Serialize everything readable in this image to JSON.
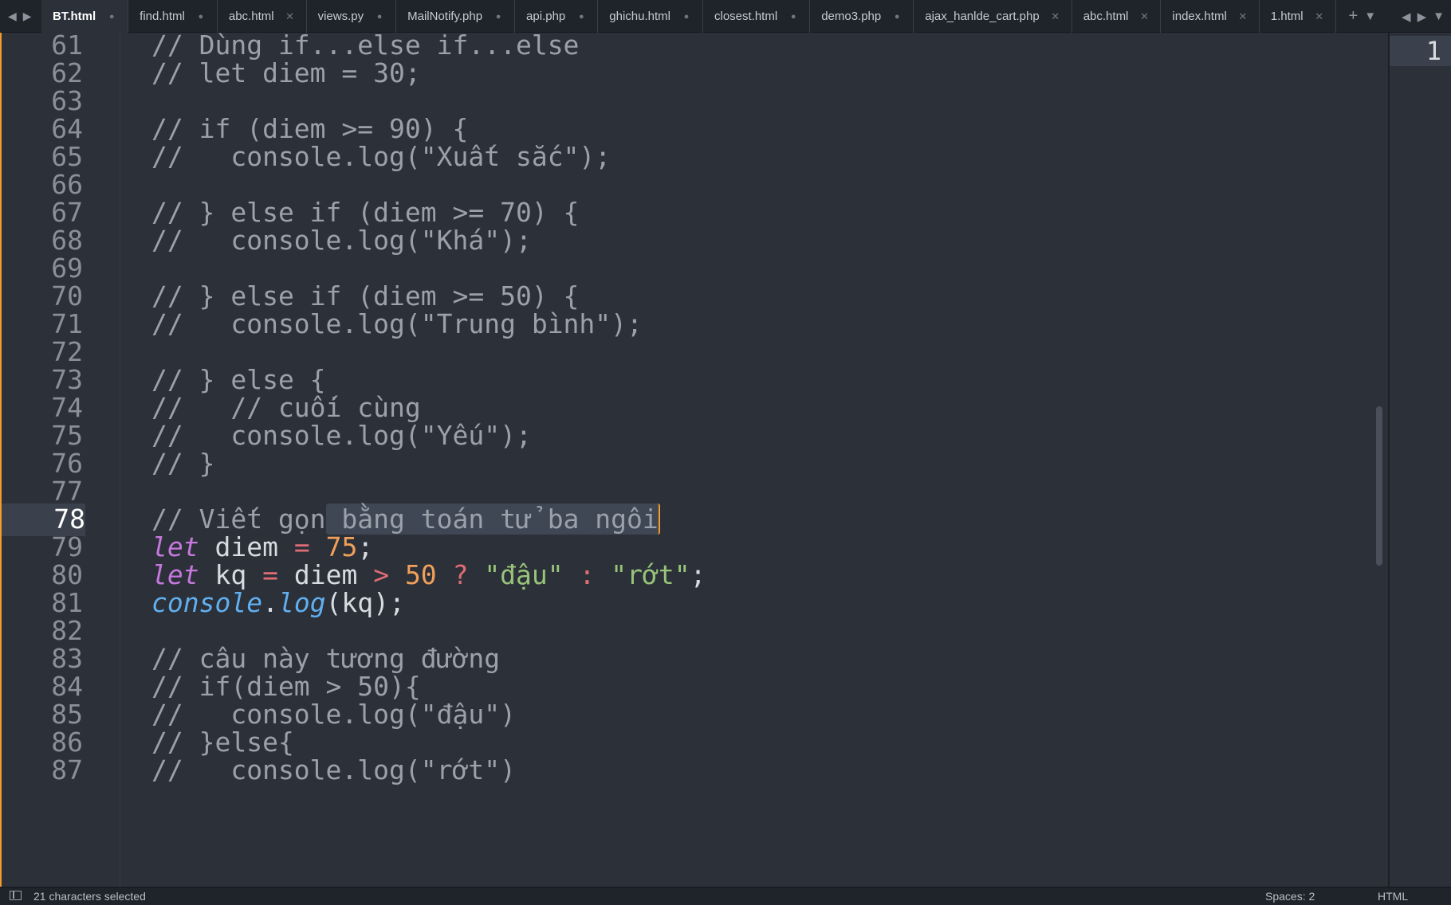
{
  "tabs": [
    {
      "label": "BT.html",
      "control": "●",
      "active": true
    },
    {
      "label": "find.html",
      "control": "●"
    },
    {
      "label": "abc.html",
      "control": "✕"
    },
    {
      "label": "views.py",
      "control": "●"
    },
    {
      "label": "MailNotify.php",
      "control": "●"
    },
    {
      "label": "api.php",
      "control": "●"
    },
    {
      "label": "ghichu.html",
      "control": "●"
    },
    {
      "label": "closest.html",
      "control": "●"
    },
    {
      "label": "demo3.php",
      "control": "●"
    },
    {
      "label": "ajax_hanlde_cart.php",
      "control": "✕"
    },
    {
      "label": "abc.html",
      "control": "✕"
    },
    {
      "label": "index.html",
      "control": "✕"
    },
    {
      "label": "1.html",
      "control": "✕"
    }
  ],
  "lines": [
    {
      "n": "61",
      "tokens": [
        [
          "cm",
          "// Dùng if...else if...else"
        ]
      ]
    },
    {
      "n": "62",
      "tokens": [
        [
          "cm",
          "// let diem = 30;"
        ]
      ]
    },
    {
      "n": "63",
      "tokens": []
    },
    {
      "n": "64",
      "tokens": [
        [
          "cm",
          "// if (diem >= 90) {"
        ]
      ]
    },
    {
      "n": "65",
      "tokens": [
        [
          "cm",
          "//   console.log(\"Xuất sắc\");"
        ]
      ]
    },
    {
      "n": "66",
      "tokens": []
    },
    {
      "n": "67",
      "tokens": [
        [
          "cm",
          "// } else if (diem >= 70) {"
        ]
      ]
    },
    {
      "n": "68",
      "tokens": [
        [
          "cm",
          "//   console.log(\"Khá\");"
        ]
      ]
    },
    {
      "n": "69",
      "tokens": []
    },
    {
      "n": "70",
      "tokens": [
        [
          "cm",
          "// } else if (diem >= 50) {"
        ]
      ]
    },
    {
      "n": "71",
      "tokens": [
        [
          "cm",
          "//   console.log(\"Trung bình\");"
        ]
      ]
    },
    {
      "n": "72",
      "tokens": []
    },
    {
      "n": "73",
      "tokens": [
        [
          "cm",
          "// } else {"
        ]
      ]
    },
    {
      "n": "74",
      "tokens": [
        [
          "cm",
          "//   // cuối cùng"
        ]
      ]
    },
    {
      "n": "75",
      "tokens": [
        [
          "cm",
          "//   console.log(\"Yếu\");"
        ]
      ]
    },
    {
      "n": "76",
      "tokens": [
        [
          "cm",
          "// }"
        ]
      ]
    },
    {
      "n": "77",
      "tokens": []
    },
    {
      "n": "78",
      "current": true,
      "tokens": [
        [
          "cm",
          "// Viết gọn"
        ],
        [
          "cm sel caret",
          " bằng toán tử ba ngôi"
        ]
      ]
    },
    {
      "n": "79",
      "tokens": [
        [
          "kw",
          "let"
        ],
        [
          "",
          " diem "
        ],
        [
          "op",
          "="
        ],
        [
          "",
          " "
        ],
        [
          "num",
          "75"
        ],
        [
          "",
          ";"
        ]
      ]
    },
    {
      "n": "80",
      "tokens": [
        [
          "kw",
          "let"
        ],
        [
          "",
          " kq "
        ],
        [
          "op",
          "="
        ],
        [
          "",
          " diem "
        ],
        [
          "op",
          ">"
        ],
        [
          "",
          " "
        ],
        [
          "num",
          "50"
        ],
        [
          "",
          " "
        ],
        [
          "op",
          "?"
        ],
        [
          "",
          " "
        ],
        [
          "str",
          "\"đậu\""
        ],
        [
          "",
          " "
        ],
        [
          "op",
          ":"
        ],
        [
          "",
          " "
        ],
        [
          "str",
          "\"rớt\""
        ],
        [
          "",
          ";"
        ]
      ]
    },
    {
      "n": "81",
      "tokens": [
        [
          "fn",
          "console"
        ],
        [
          "",
          "."
        ],
        [
          "fn",
          "log"
        ],
        [
          "",
          "(kq);"
        ]
      ]
    },
    {
      "n": "82",
      "tokens": []
    },
    {
      "n": "83",
      "tokens": [
        [
          "cm",
          "// câu này tương đường"
        ]
      ]
    },
    {
      "n": "84",
      "tokens": [
        [
          "cm",
          "// if(diem > 50){"
        ]
      ]
    },
    {
      "n": "85",
      "tokens": [
        [
          "cm",
          "//   console.log(\"đậu\")"
        ]
      ]
    },
    {
      "n": "86",
      "tokens": [
        [
          "cm",
          "// }else{"
        ]
      ]
    },
    {
      "n": "87",
      "tokens": [
        [
          "cm",
          "//   console.log(\"rớt\")"
        ]
      ]
    }
  ],
  "minimap": {
    "line_number": "1"
  },
  "status": {
    "selection": "21 characters selected",
    "spaces": "Spaces: 2",
    "syntax": "HTML"
  }
}
